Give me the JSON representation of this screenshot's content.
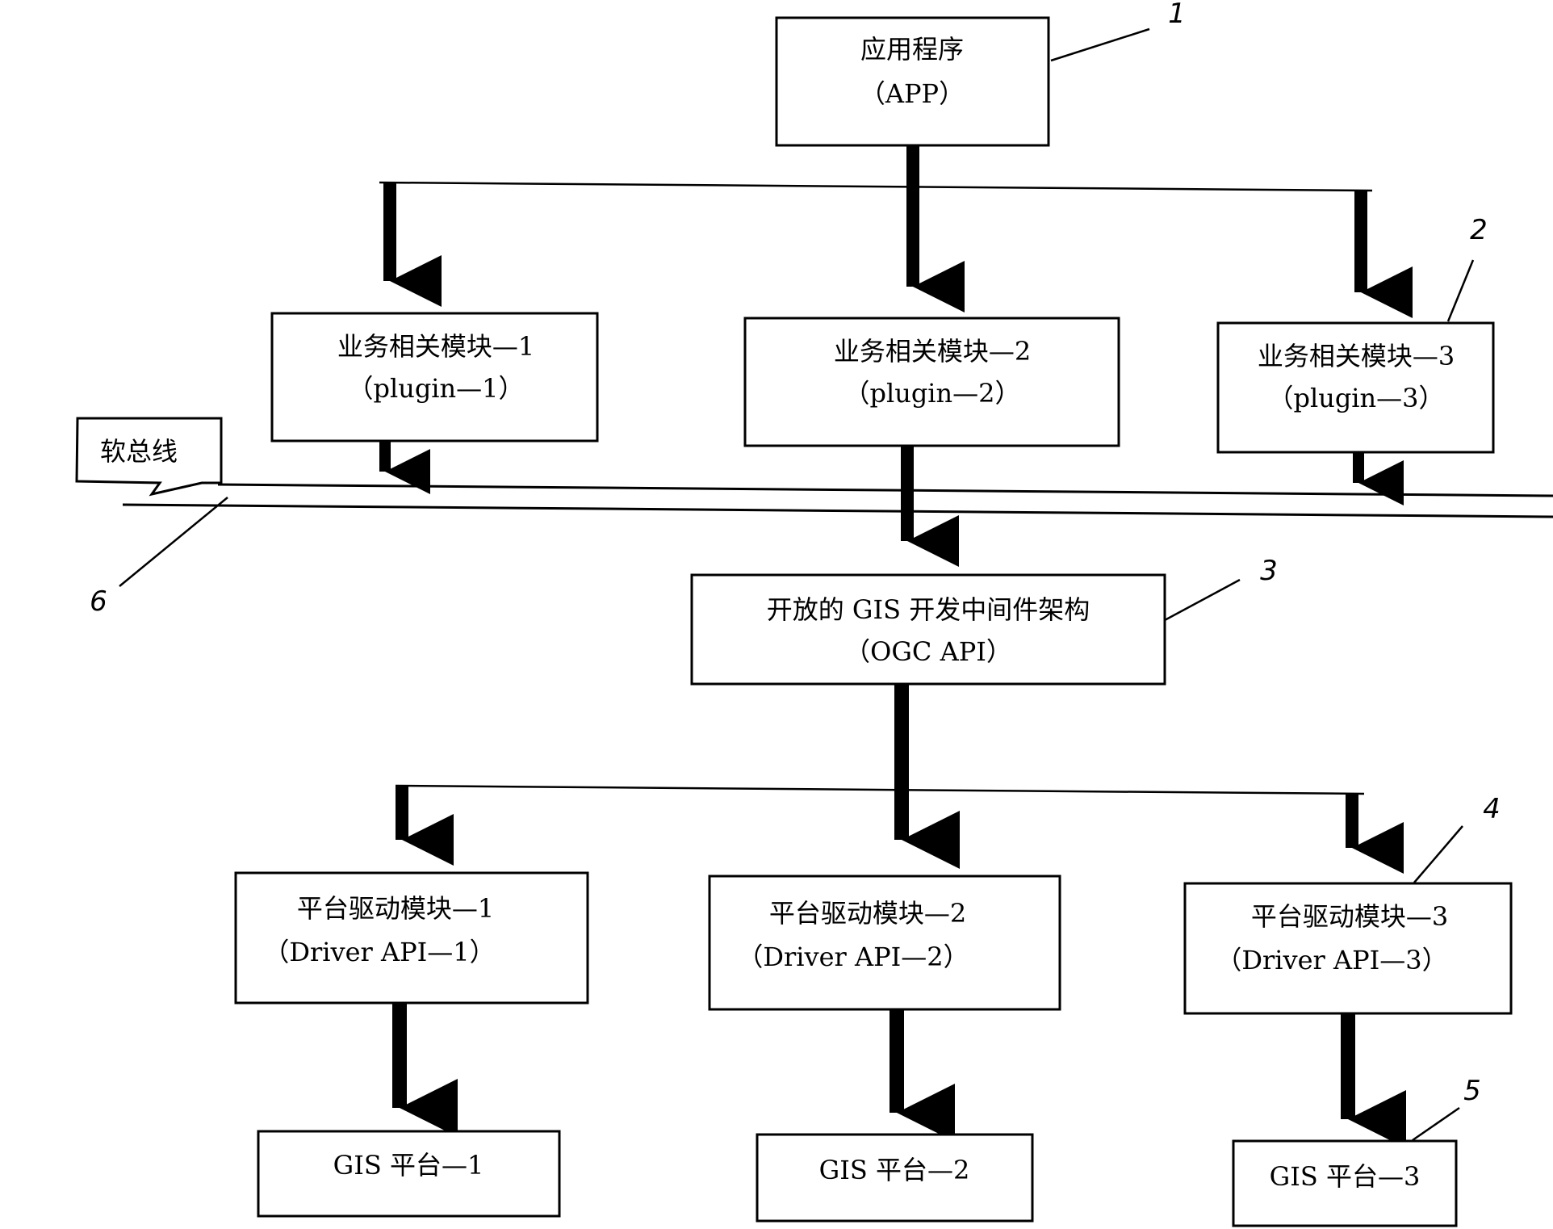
{
  "diagram": {
    "app": {
      "line1": "应用程序",
      "line2": "（APP）",
      "ref": "1"
    },
    "plugins": [
      {
        "line1": "业务相关模块—1",
        "line2": "（plugin—1）"
      },
      {
        "line1": "业务相关模块—2",
        "line2": "（plugin—2）"
      },
      {
        "line1": "业务相关模块—3",
        "line2": "（plugin—3）",
        "ref": "2"
      }
    ],
    "bus": {
      "label": "软总线",
      "ref": "6"
    },
    "middleware": {
      "line1": "开放的 GIS 开发中间件架构",
      "line2": "（OGC API）",
      "ref": "3"
    },
    "drivers": [
      {
        "line1": "平台驱动模块—1",
        "line2": "（Driver API—1）"
      },
      {
        "line1": "平台驱动模块—2",
        "line2": "（Driver API—2）"
      },
      {
        "line1": "平台驱动模块—3",
        "line2": "（Driver API—3）",
        "ref": "4"
      }
    ],
    "platforms": [
      {
        "label": "GIS 平台—1"
      },
      {
        "label": "GIS 平台—2"
      },
      {
        "label": "GIS 平台—3",
        "ref": "5"
      }
    ]
  }
}
